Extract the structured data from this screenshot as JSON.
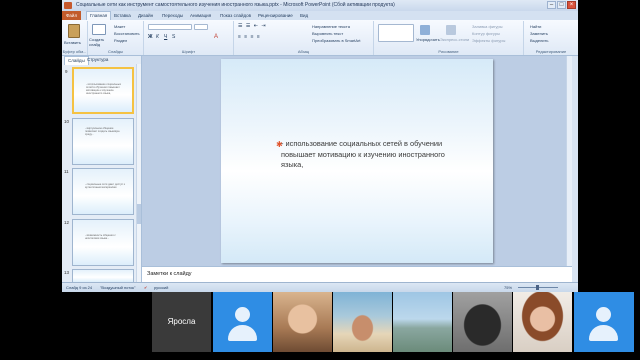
{
  "window": {
    "title": "Социальные сети как инструмент самостоятельного изучения иностранного языка.pptx - Microsoft PowerPoint (Сбой активации продукта)"
  },
  "ribbon": {
    "tabs": [
      "Файл",
      "Главная",
      "Вставка",
      "Дизайн",
      "Переходы",
      "Анимация",
      "Показ слайдов",
      "Рецензирование",
      "Вид"
    ],
    "groups": {
      "clipboard": {
        "label": "Буфер обм...",
        "paste": "Вставить"
      },
      "slides": {
        "label": "Слайды",
        "new_slide": "Создать слайд",
        "layout": "Макет",
        "reset": "Восстановить",
        "section": "Раздел"
      },
      "font": {
        "label": "Шрифт"
      },
      "paragraph": {
        "label": "Абзац",
        "text_direction": "Направление текста",
        "align_text": "Выровнять текст",
        "smartart": "Преобразовать в SmartArt"
      },
      "drawing": {
        "label": "Рисование",
        "arrange": "Упорядочить",
        "quick_styles": "Экспресс-стили",
        "fill": "Заливка фигуры",
        "outline": "Контур фигуры",
        "effects": "Эффекты фигуры"
      },
      "editing": {
        "label": "Редактирование",
        "find": "Найти",
        "replace": "Заменить",
        "select": "Выделить"
      }
    }
  },
  "slides_pane": {
    "tabs": [
      "Слайды",
      "Структура"
    ],
    "thumbnails": [
      {
        "num": "9",
        "text": "- использование социальных сетей в обучении повышает мотивацию к изучению иностранного языка,"
      },
      {
        "num": "10",
        "text": "- виртуальное общение позволяет создать языковую среду..."
      },
      {
        "num": "11",
        "text": "- социальные сети дают доступ к аутентичным материалам"
      },
      {
        "num": "12",
        "text": "- возможность общения с носителями языка..."
      },
      {
        "num": "13",
        "text": ""
      }
    ]
  },
  "slide": {
    "body": "- использование социальных сетей в обучении повышает мотивацию к изучению иностранного языка,"
  },
  "notes": {
    "placeholder": "Заметки к слайду"
  },
  "status": {
    "slide_info": "Слайд 9 из 24",
    "theme": "\"Воздушный поток\"",
    "language": "русский",
    "zoom": "75%"
  },
  "call": {
    "participant_name": "Яросла"
  },
  "colors": {
    "file_tab": "#c25b2b",
    "avatar_bg": "#2f8de4",
    "bullet": "#e0542c"
  }
}
